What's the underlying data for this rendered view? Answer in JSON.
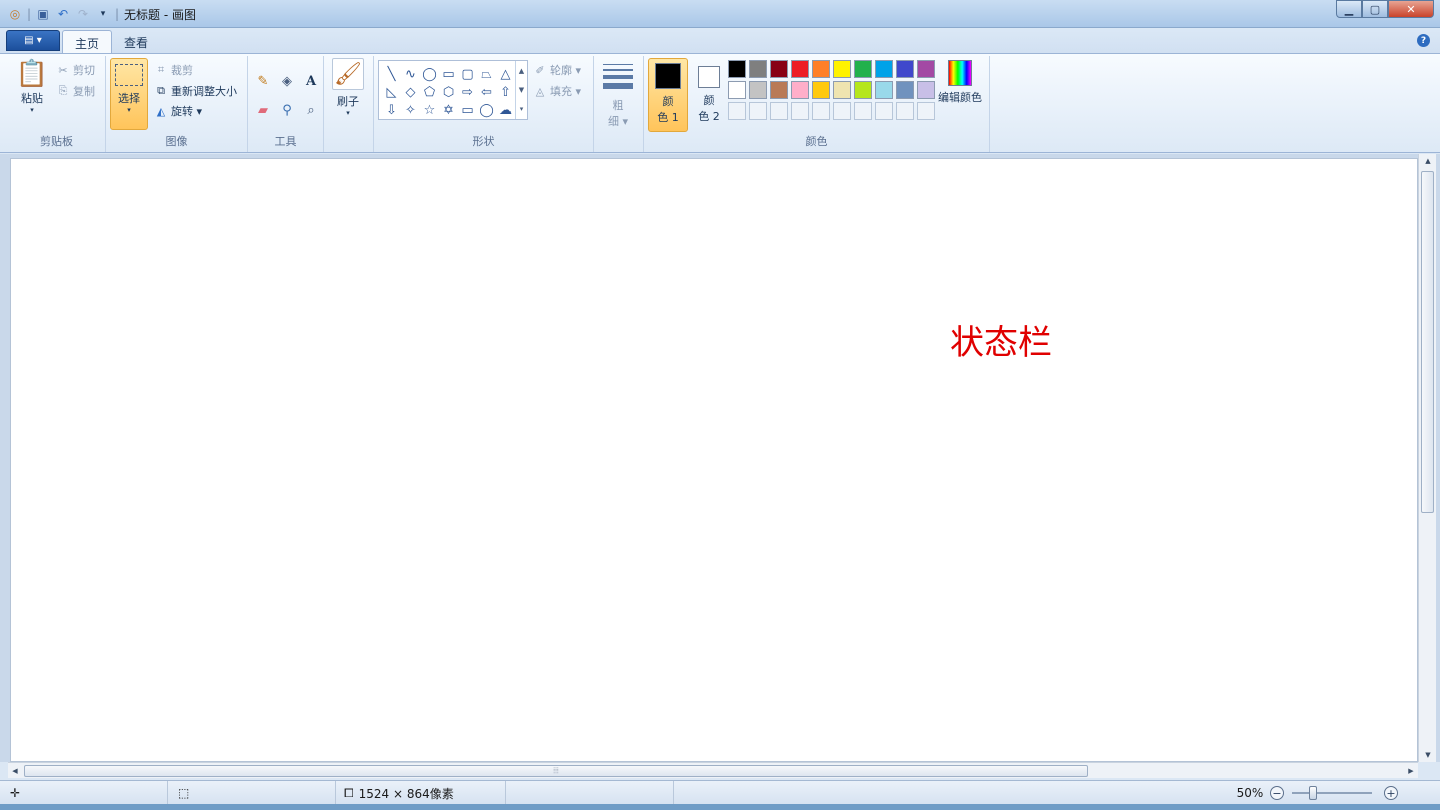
{
  "window": {
    "title": "无标题 - 画图"
  },
  "quick_access": {
    "icons": [
      "app-icon",
      "save-icon",
      "undo-icon",
      "redo-icon",
      "customize-icon"
    ]
  },
  "tabs": {
    "file_menu": "▤ ▾",
    "home": "主页",
    "view": "查看"
  },
  "clipboard": {
    "paste": "粘贴",
    "cut": "剪切",
    "copy": "复制",
    "group_label": "剪贴板"
  },
  "image": {
    "select": "选择",
    "crop": "裁剪",
    "resize": "重新调整大小",
    "rotate": "旋转 ▾",
    "group_label": "图像"
  },
  "tools": {
    "group_label": "工具"
  },
  "brushes": {
    "label": "刷子"
  },
  "shapes": {
    "outline": "轮廓 ▾",
    "fill": "填充 ▾",
    "group_label": "形状"
  },
  "size": {
    "label_line1": "粗",
    "label_line2": "细 ▾"
  },
  "colors": {
    "color1_line1": "颜",
    "color1_line2": "色 1",
    "color2_line1": "颜",
    "color2_line2": "色 2",
    "edit": "编辑颜色",
    "group_label": "颜色",
    "color1_value": "#000000",
    "color2_value": "#ffffff",
    "palette_row1": [
      "#000000",
      "#7f7f7f",
      "#880015",
      "#ed1c24",
      "#ff7f27",
      "#fff200",
      "#22b14c",
      "#00a2e8",
      "#3f48cc",
      "#a349a4"
    ],
    "palette_row2": [
      "#ffffff",
      "#c3c3c3",
      "#b97a57",
      "#ffaec9",
      "#ffc90e",
      "#efe4b0",
      "#b5e61d",
      "#99d9ea",
      "#7092be",
      "#c8bfe7"
    ]
  },
  "canvas": {
    "annotation": "状态栏"
  },
  "statusbar": {
    "dimensions": "1524 × 864像素",
    "zoom": "50%"
  }
}
